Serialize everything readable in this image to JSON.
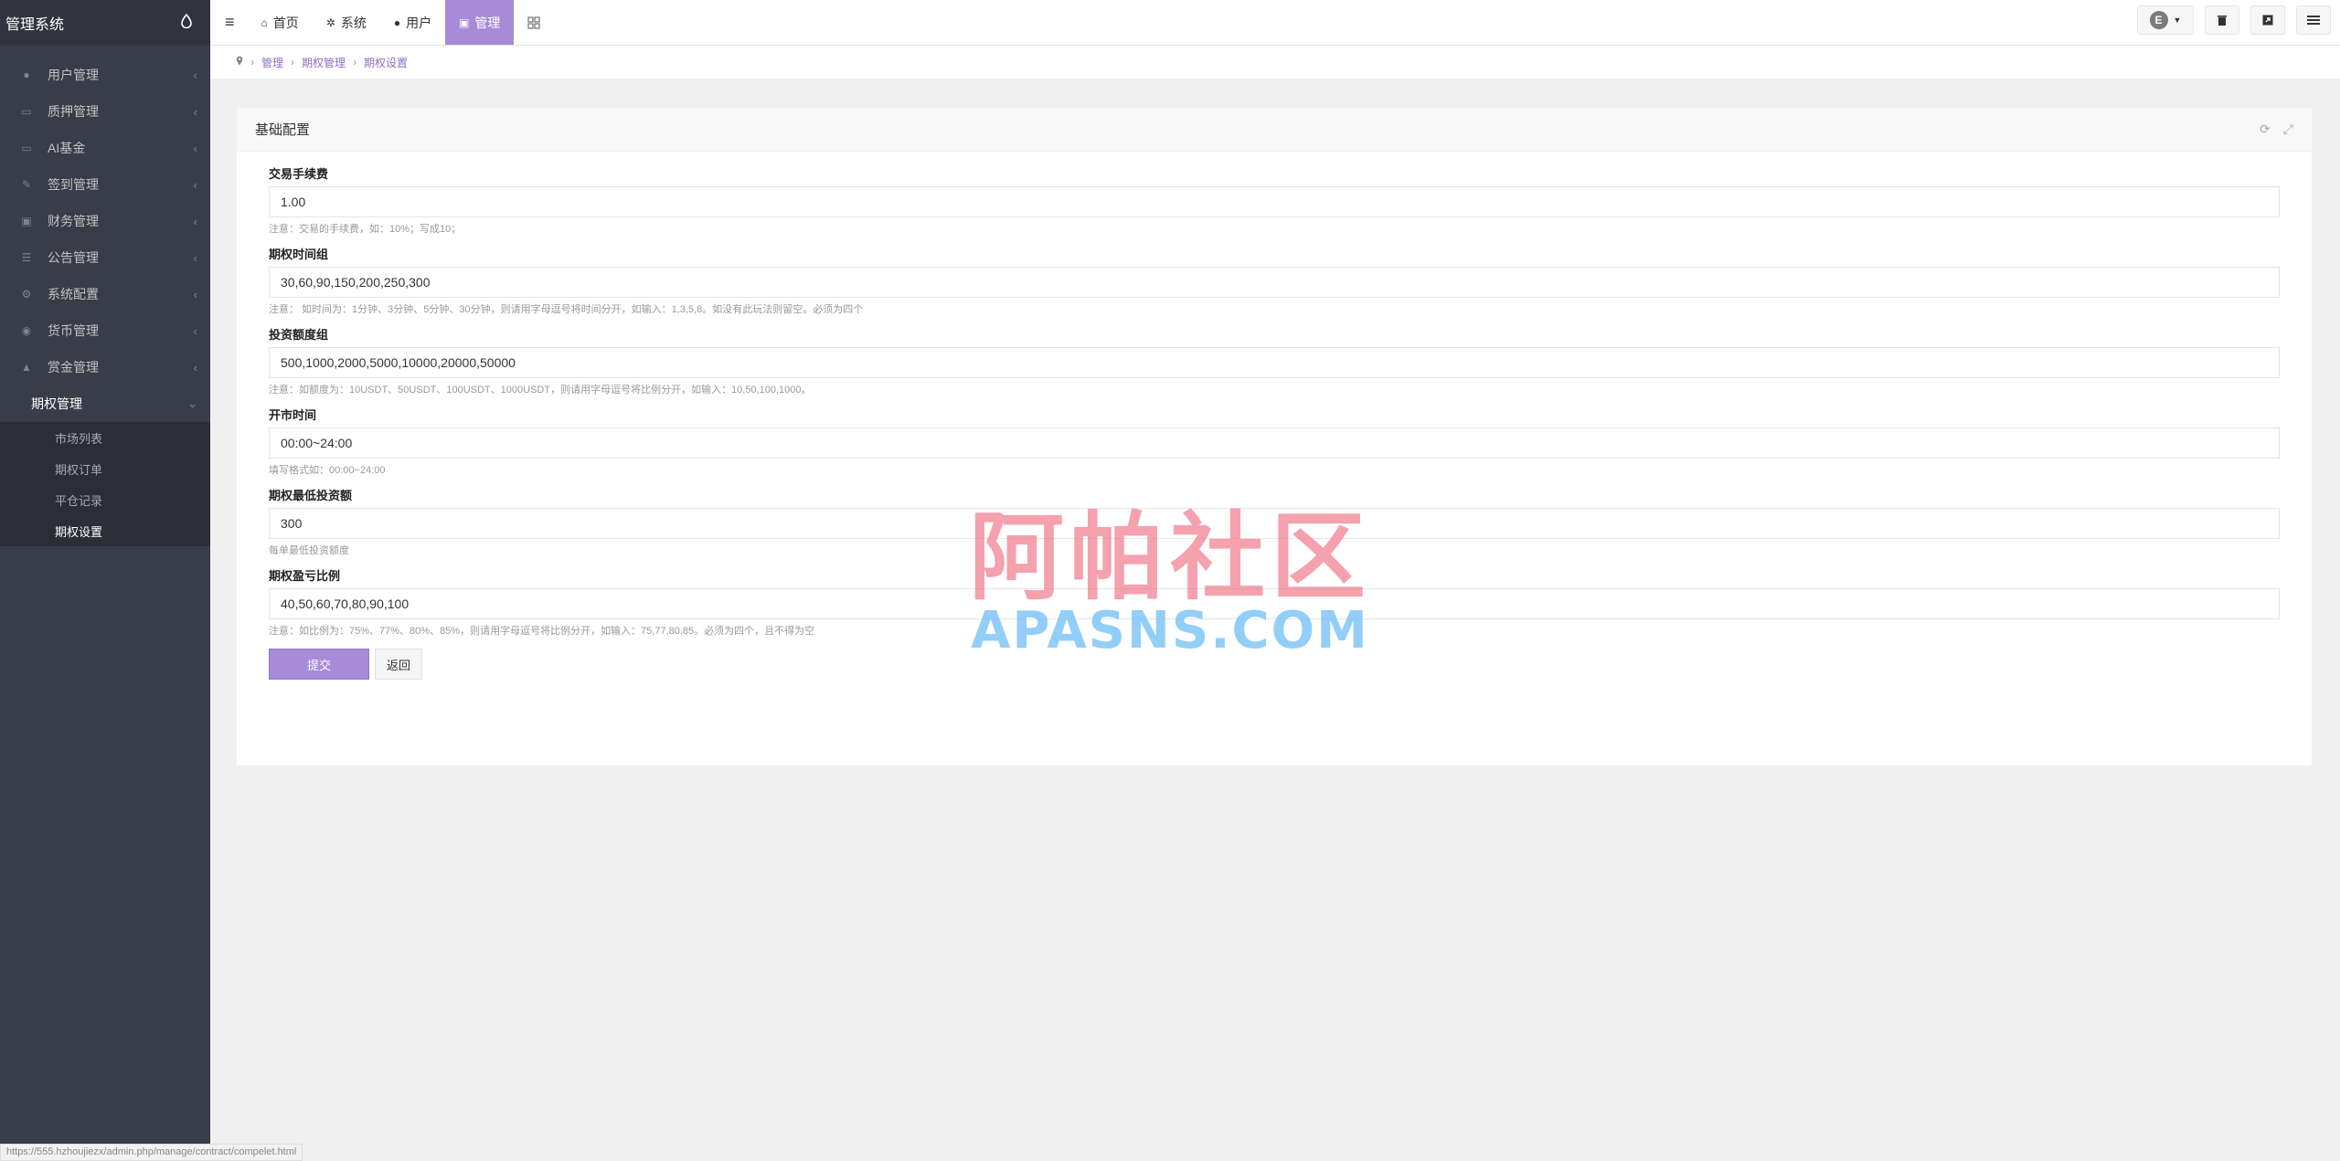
{
  "sidebar": {
    "brand": "管理系统",
    "brand_icon": "water-drop-icon",
    "items": [
      {
        "label": "用户管理",
        "icon": "user-icon",
        "glyph": "●"
      },
      {
        "label": "质押管理",
        "icon": "list-icon",
        "glyph": "▭"
      },
      {
        "label": "AI基金",
        "icon": "monitor-icon",
        "glyph": "▭"
      },
      {
        "label": "签到管理",
        "icon": "edit-icon",
        "glyph": "✎"
      },
      {
        "label": "财务管理",
        "icon": "money-icon",
        "glyph": "▣"
      },
      {
        "label": "公告管理",
        "icon": "list-icon",
        "glyph": "☰"
      },
      {
        "label": "系统配置",
        "icon": "cogs-icon",
        "glyph": "⚙"
      },
      {
        "label": "货币管理",
        "icon": "coin-icon",
        "glyph": "◉"
      },
      {
        "label": "赏金管理",
        "icon": "bank-icon",
        "glyph": "▲"
      }
    ],
    "open_item": "期权管理",
    "sub_items": [
      {
        "label": "市场列表",
        "active": false
      },
      {
        "label": "期权订单",
        "active": false
      },
      {
        "label": "平仓记录",
        "active": false
      },
      {
        "label": "期权设置",
        "active": true
      }
    ]
  },
  "header": {
    "menu_icon": "hamburger-icon",
    "nav": [
      {
        "label": "首页",
        "icon": "home-icon",
        "glyph": "⌂",
        "active": false
      },
      {
        "label": "系统",
        "icon": "gear-icon",
        "glyph": "✲",
        "active": false
      },
      {
        "label": "用户",
        "icon": "user-icon",
        "glyph": "●",
        "active": false
      },
      {
        "label": "管理",
        "icon": "briefcase-icon",
        "glyph": "▣",
        "active": true
      }
    ],
    "grid_icon": "grid-icon",
    "avatar_letter": "E"
  },
  "breadcrumb": {
    "items": [
      "管理",
      "期权管理",
      "期权设置"
    ]
  },
  "panel": {
    "title": "基础配置"
  },
  "form": {
    "fields": [
      {
        "label": "交易手续费",
        "value": "1.00",
        "hint": "注意：交易的手续费，如：10%；写成10；"
      },
      {
        "label": "期权时间组",
        "value": "30,60,90,150,200,250,300",
        "hint": "注意： 如时间为：1分钟、3分钟、5分钟、30分钟，则请用字母逗号将时间分开，如输入：1,3,5,8。如没有此玩法则留空。必须为四个"
      },
      {
        "label": "投资额度组",
        "value": "500,1000,2000,5000,10000,20000,50000",
        "hint": "注意：如额度为：10USDT、50USDT、100USDT、1000USDT，则请用字母逗号将比例分开，如输入：10,50,100,1000。"
      },
      {
        "label": "开市时间",
        "value": "00:00~24:00",
        "hint": "填写格式如：00:00~24:00"
      },
      {
        "label": "期权最低投资额",
        "value": "300",
        "hint": "每单最低投资额度"
      },
      {
        "label": "期权盈亏比例",
        "value": "40,50,60,70,80,90,100",
        "hint": "注意：如比例为：75%、77%、80%、85%，则请用字母逗号将比例分开，如输入：75,77,80,85。必须为四个，且不得为空"
      }
    ],
    "submit_label": "提交",
    "back_label": "返回"
  },
  "watermark": {
    "cn": "阿帕社区",
    "en": "APASNS.COM"
  },
  "status_url": "https://555.hzhoujiezx/admin.php/manage/contract/compelet.html",
  "colors": {
    "accent": "#a78bd8",
    "sidebar_bg": "#393d49",
    "submenu_bg": "#2b2e37"
  }
}
